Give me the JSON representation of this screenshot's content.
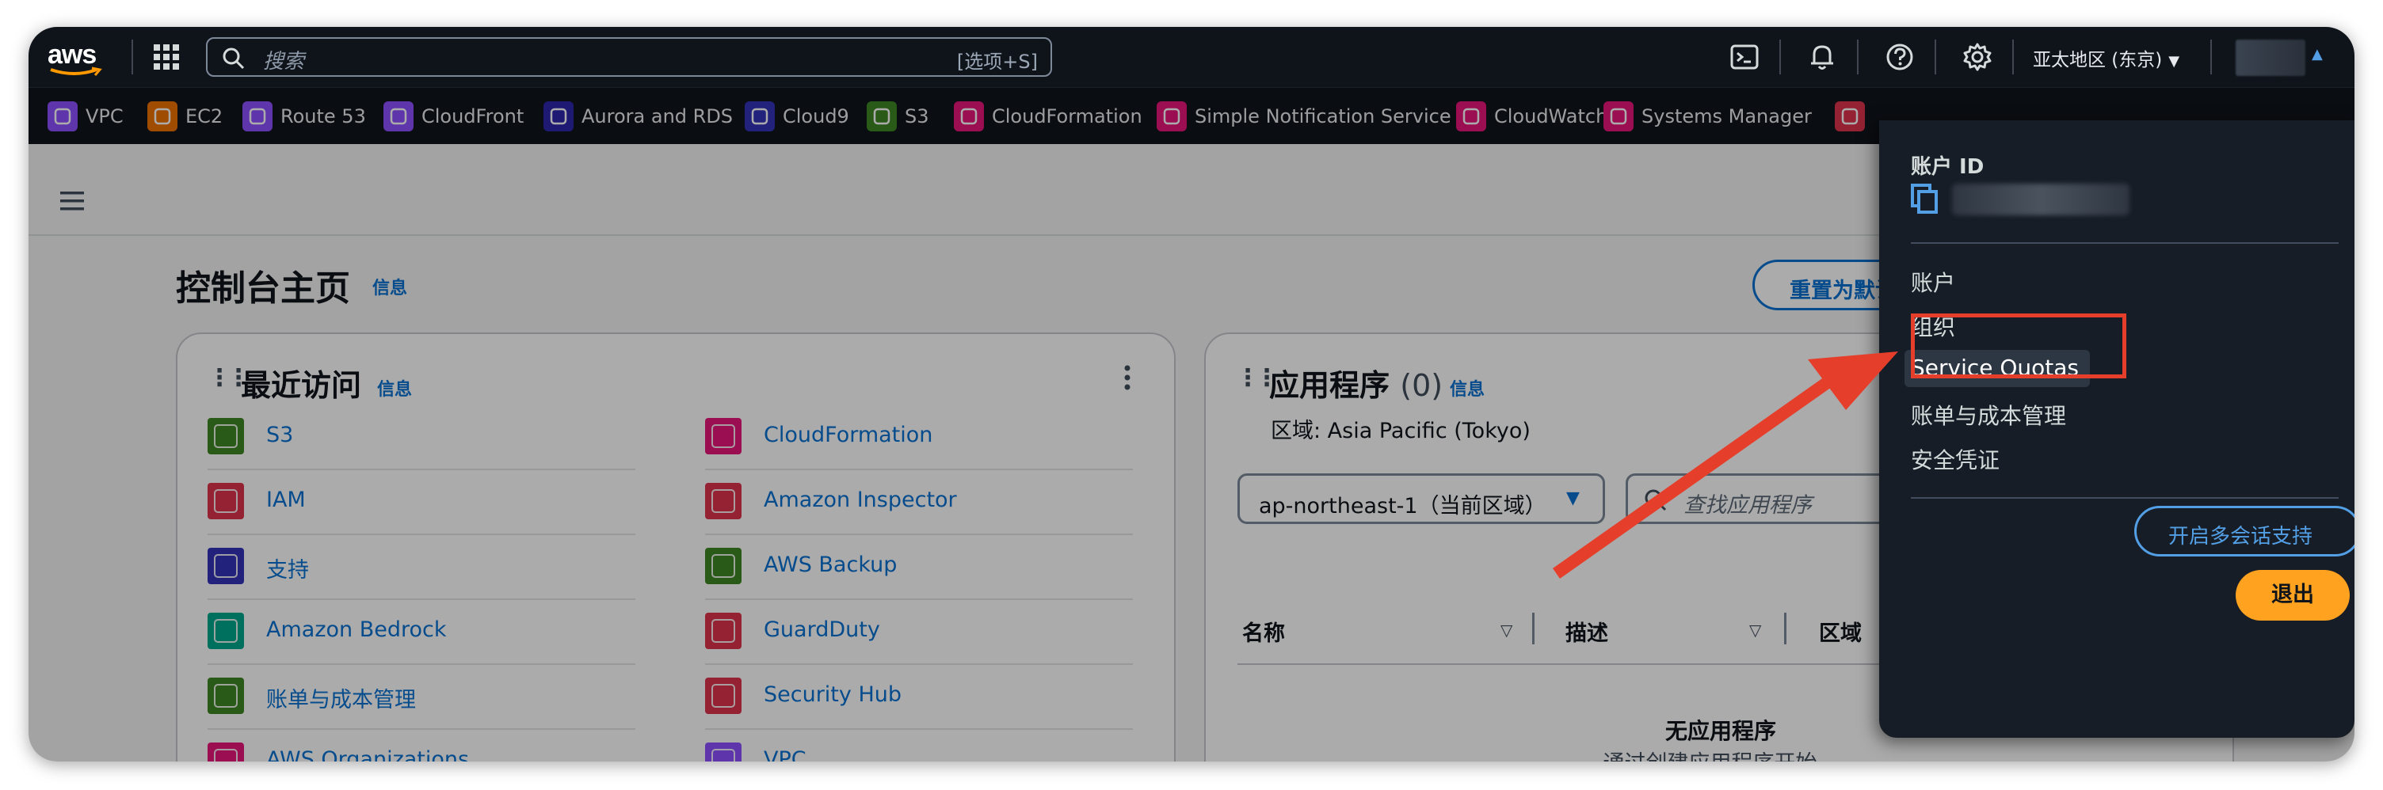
{
  "topbar": {
    "logo": "aws",
    "search_placeholder": "搜索",
    "search_shortcut": "[选项+S]",
    "region": "亚太地区 (东京)",
    "icons": [
      "cloudshell-icon",
      "bell-icon",
      "help-icon",
      "gear-icon"
    ]
  },
  "services": [
    {
      "label": "VPC",
      "color": "#8c4fff"
    },
    {
      "label": "EC2",
      "color": "#ed7100"
    },
    {
      "label": "Route 53",
      "color": "#8c4fff"
    },
    {
      "label": "CloudFront",
      "color": "#8c4fff"
    },
    {
      "label": "Aurora and RDS",
      "color": "#2e27ad"
    },
    {
      "label": "Cloud9",
      "color": "#3334b9"
    },
    {
      "label": "S3",
      "color": "#3f8624"
    },
    {
      "label": "CloudFormation",
      "color": "#e7157b"
    },
    {
      "label": "Simple Notification Service",
      "color": "#e7157b"
    },
    {
      "label": "CloudWatch",
      "color": "#e7157b"
    },
    {
      "label": "Systems Manager",
      "color": "#e7157b"
    },
    {
      "label": "",
      "color": "#dd344c"
    }
  ],
  "page": {
    "title": "控制台主页",
    "info": "信息",
    "reset_button": "重置为默认"
  },
  "recent": {
    "title": "最近访问",
    "info": "信息",
    "left": [
      {
        "label": "S3",
        "color": "#3f8624"
      },
      {
        "label": "IAM",
        "color": "#dd344c"
      },
      {
        "label": "支持",
        "color": "#3334b9"
      },
      {
        "label": "Amazon Bedrock",
        "color": "#01a88d"
      },
      {
        "label": "账单与成本管理",
        "color": "#3f8624"
      },
      {
        "label": "AWS Organizations",
        "color": "#e7157b"
      }
    ],
    "right": [
      {
        "label": "CloudFormation",
        "color": "#e7157b"
      },
      {
        "label": "Amazon Inspector",
        "color": "#dd344c"
      },
      {
        "label": "AWS Backup",
        "color": "#3f8624"
      },
      {
        "label": "GuardDuty",
        "color": "#dd344c"
      },
      {
        "label": "Security Hub",
        "color": "#dd344c"
      },
      {
        "label": "VPC",
        "color": "#8c4fff"
      }
    ]
  },
  "apps": {
    "title": "应用程序",
    "count": "(0)",
    "info": "信息",
    "region_label": "区域: Asia Pacific (Tokyo)",
    "region_select": "ap-northeast-1（当前区域）",
    "search_placeholder": "查找应用程序",
    "columns": [
      "名称",
      "描述",
      "区域"
    ],
    "empty_title": "无应用程序",
    "empty_desc": "通过创建应用程序开始。"
  },
  "account_menu": {
    "account_id_label": "账户 ID",
    "items": [
      "账户",
      "组织",
      "Service Quotas",
      "账单与成本管理",
      "安全凭证"
    ],
    "highlighted_item": "Service Quotas",
    "multi_session_button": "开启多会话支持",
    "logout_button": "退出"
  }
}
